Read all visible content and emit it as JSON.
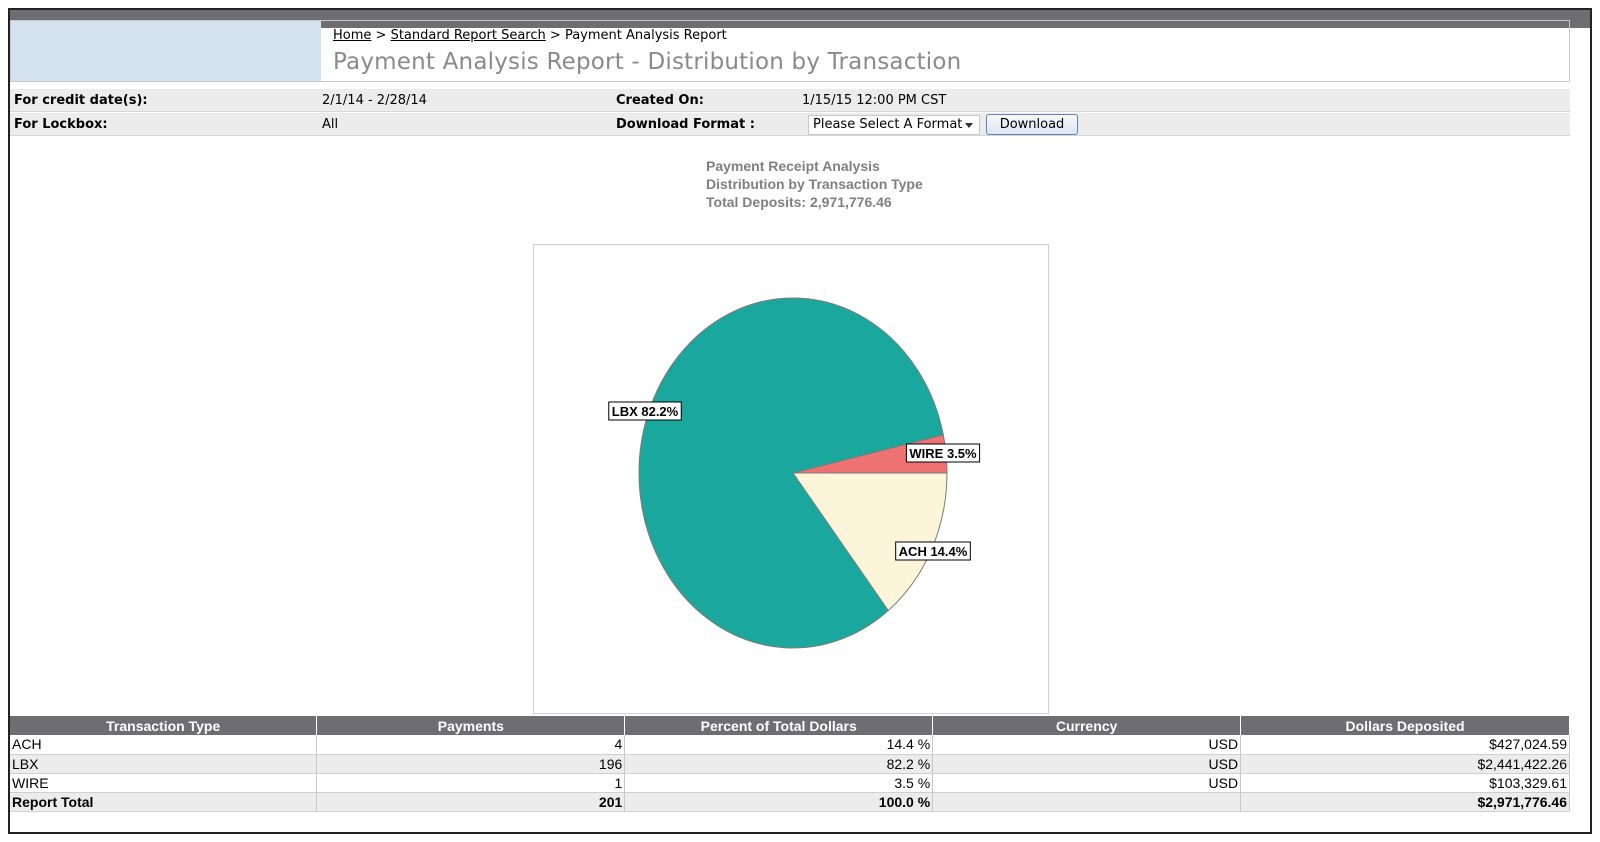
{
  "breadcrumb": {
    "home": "Home",
    "sep1": ">",
    "search": "Standard Report Search",
    "sep2": ">",
    "current": "Payment Analysis Report"
  },
  "page_title": "Payment Analysis Report - Distribution by Transaction",
  "meta": {
    "credit_date_label": "For credit date(s):",
    "credit_date_value": "2/1/14 - 2/28/14",
    "created_on_label": "Created On:",
    "created_on_value": "1/15/15 12:00 PM CST",
    "lockbox_label": "For Lockbox:",
    "lockbox_value": "All",
    "download_format_label": "Download Format :",
    "format_select_value": "Please Select A Format",
    "download_button": "Download"
  },
  "chart_heading": {
    "line1": "Payment Receipt Analysis",
    "line2": "Distribution by Transaction Type",
    "line3": "Total Deposits: 2,971,776.46"
  },
  "chart_data": {
    "type": "pie",
    "slices": [
      {
        "label": "LBX 82.2%",
        "name": "LBX",
        "value": 82.2,
        "color": "#1aa89e"
      },
      {
        "label": "WIRE 3.5%",
        "name": "WIRE",
        "value": 3.5,
        "color": "#ee7272"
      },
      {
        "label": "ACH 14.4%",
        "name": "ACH",
        "value": 14.4,
        "color": "#fdf5d9"
      }
    ]
  },
  "table": {
    "headers": [
      "Transaction Type",
      "Payments",
      "Percent of Total Dollars",
      "Currency",
      "Dollars Deposited"
    ],
    "rows": [
      [
        "ACH",
        "4",
        "14.4 %",
        "USD",
        "$427,024.59"
      ],
      [
        "LBX",
        "196",
        "82.2 %",
        "USD",
        "$2,441,422.26"
      ],
      [
        "WIRE",
        "1",
        "3.5 %",
        "USD",
        "$103,329.61"
      ]
    ],
    "total": [
      "Report Total",
      "201",
      "100.0 %",
      "",
      "$2,971,776.46"
    ]
  }
}
